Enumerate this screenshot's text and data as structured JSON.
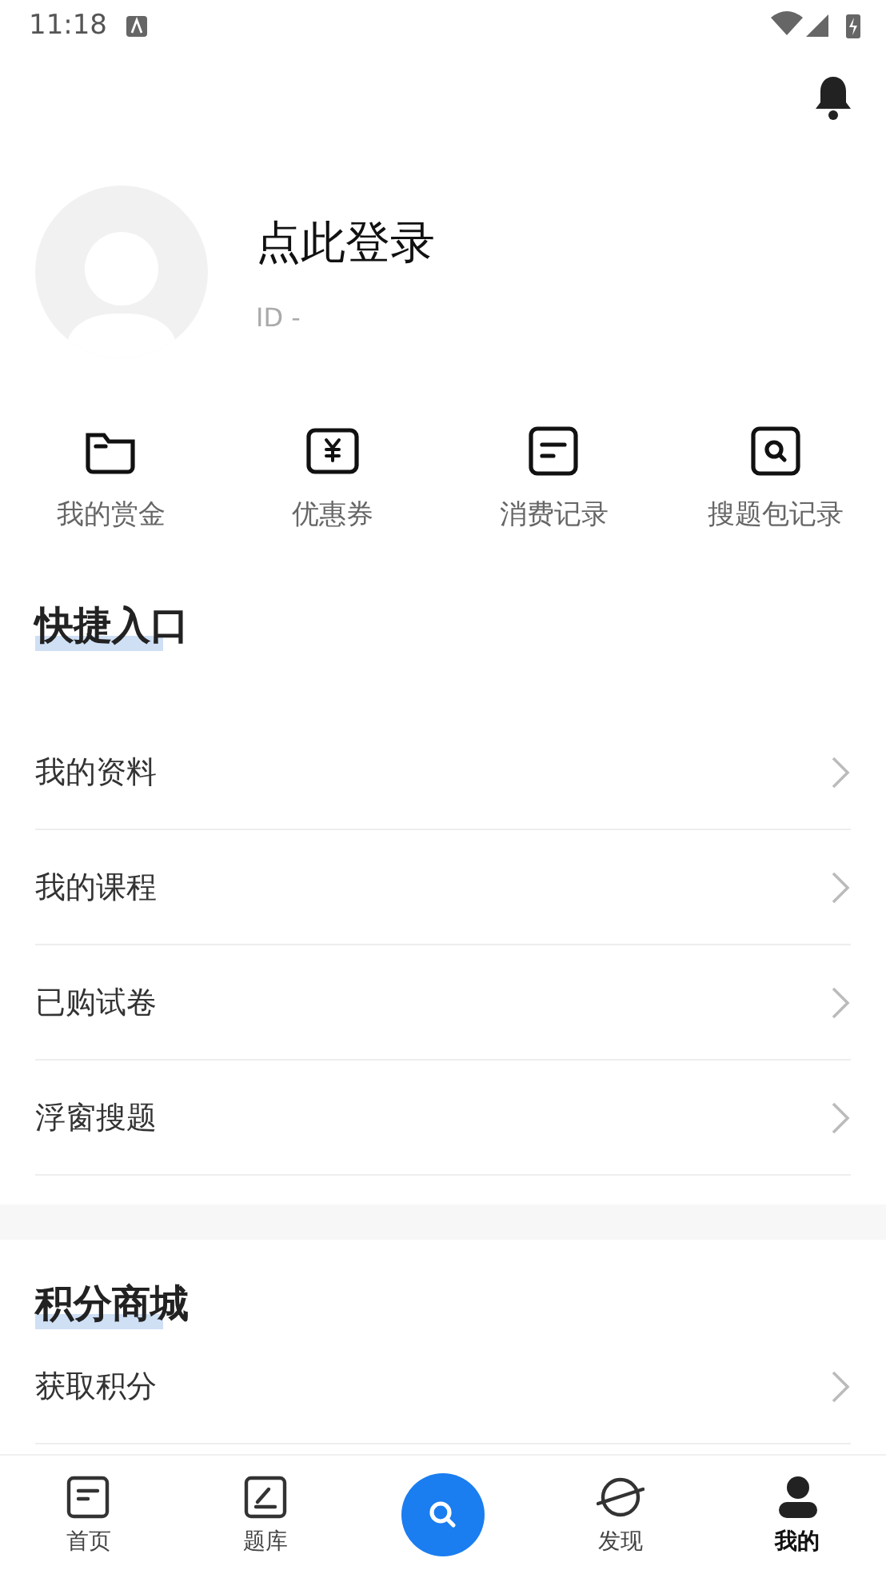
{
  "status_bar": {
    "time": "11:18"
  },
  "profile": {
    "name": "点此登录",
    "id": "ID -"
  },
  "shortcuts": [
    {
      "kind": "folder",
      "label": "我的赏金"
    },
    {
      "kind": "coupon",
      "label": "优惠券"
    },
    {
      "kind": "record",
      "label": "消费记录"
    },
    {
      "kind": "search",
      "label": "搜题包记录"
    }
  ],
  "sections": [
    {
      "title": "快捷入口",
      "items": [
        "我的资料",
        "我的课程",
        "已购试卷",
        "浮窗搜题"
      ]
    },
    {
      "title": "积分商城",
      "items": [
        "获取积分"
      ]
    }
  ],
  "bottom_nav": [
    {
      "kind": "home",
      "label": "首页",
      "selected": false
    },
    {
      "kind": "bank",
      "label": "题库",
      "selected": false
    },
    {
      "kind": "search"
    },
    {
      "kind": "discover",
      "label": "发现",
      "selected": false
    },
    {
      "kind": "me",
      "label": "我的",
      "selected": true
    }
  ]
}
